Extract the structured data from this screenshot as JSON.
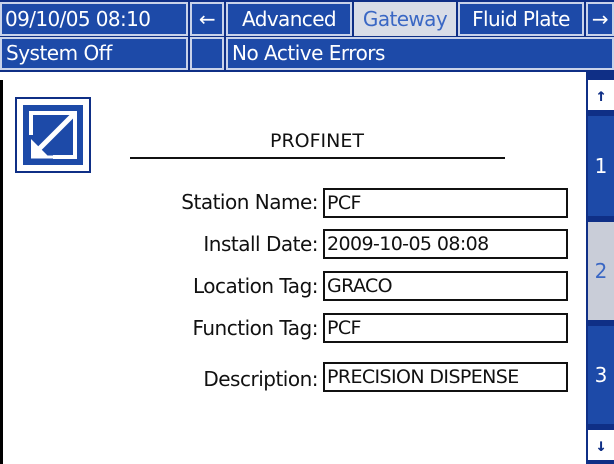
{
  "header": {
    "datetime": "09/10/05 08:10",
    "back_arrow": "←",
    "forward_arrow": "→",
    "tabs": [
      {
        "label": "Advanced",
        "selected": false
      },
      {
        "label": "Gateway",
        "selected": true
      },
      {
        "label": "Fluid Plate",
        "selected": false
      }
    ]
  },
  "status": {
    "system": "System Off",
    "errors": "No Active Errors"
  },
  "main": {
    "title": "PROFINET",
    "edit_icon": "edit-icon",
    "fields": [
      {
        "label": "Station Name:",
        "value": "PCF"
      },
      {
        "label": "Install Date:",
        "value": "2009-10-05 08:08"
      },
      {
        "label": "Location Tag:",
        "value": "GRACO"
      },
      {
        "label": "Function Tag:",
        "value": "PCF"
      },
      {
        "label": "Description:",
        "value": "PRECISION DISPENSE"
      }
    ]
  },
  "pager": {
    "up": "↑",
    "down": "↓",
    "pages": [
      {
        "label": "1",
        "selected": false
      },
      {
        "label": "2",
        "selected": true
      },
      {
        "label": "3",
        "selected": false
      }
    ]
  },
  "colors": {
    "dark_blue": "#0f2f86",
    "button_blue": "#1d4aa8",
    "selected_gray": "#d9dde7"
  }
}
